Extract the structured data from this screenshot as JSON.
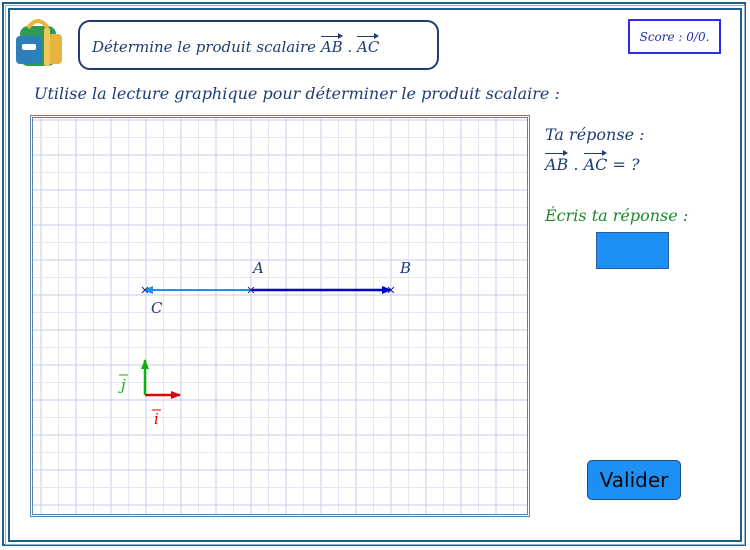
{
  "header": {
    "title_prefix": "Détermine le produit scalaire",
    "vec1": "AB",
    "separator": ".",
    "vec2": "AC"
  },
  "score": {
    "text": "Score : 0/0."
  },
  "instruction": "Utilise la lecture graphique pour déterminer le produit scalaire :",
  "answer_panel": {
    "label": "Ta réponse :",
    "vec1": "AB",
    "separator": ".",
    "vec2": "AC",
    "equals": "= ?",
    "write_label": "Écris ta réponse :",
    "input_value": ""
  },
  "buttons": {
    "validate": "Valider"
  },
  "figure": {
    "points": {
      "A": "A",
      "B": "B",
      "C": "C"
    },
    "unit_i": "i",
    "unit_j": "j"
  },
  "colors": {
    "frame": "#1f5f8b",
    "title": "#1f3d73",
    "vector_AB": "#0000d0",
    "vector_AC": "#1e90f5",
    "unit_i": "#e00000",
    "unit_j": "#10b010",
    "grid": "#c9c9ec"
  }
}
